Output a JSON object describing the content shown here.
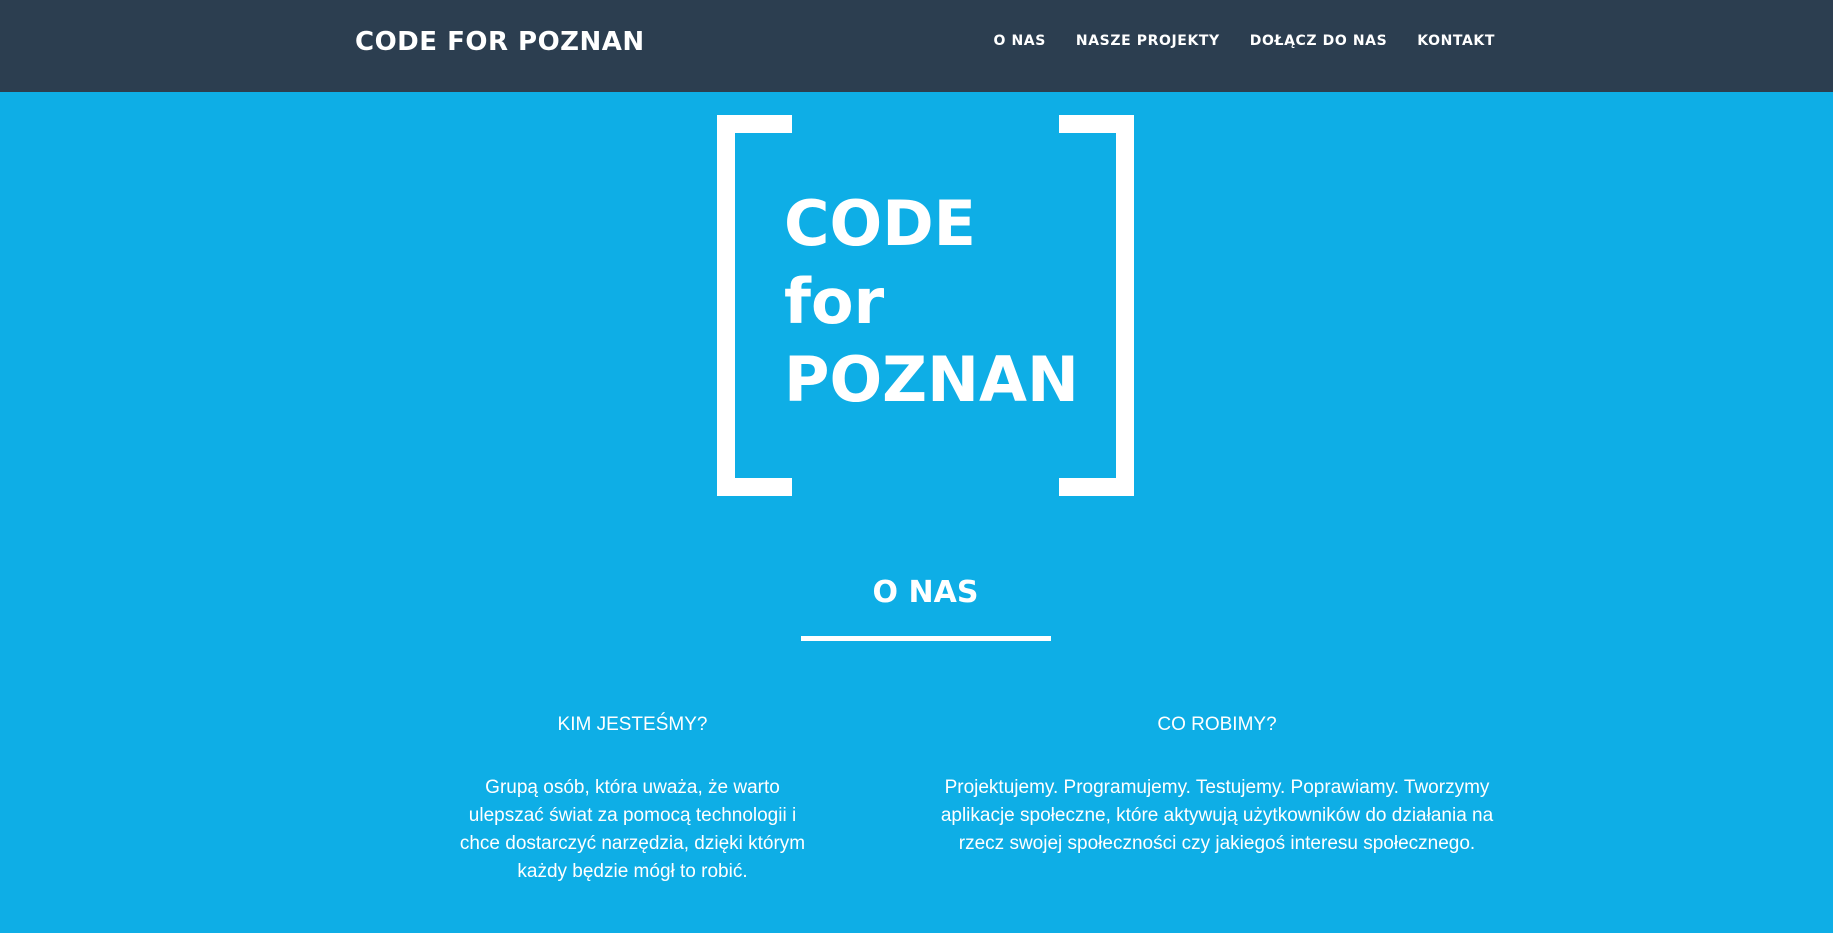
{
  "navbar": {
    "brand": "CODE FOR POZNAN",
    "links": [
      {
        "label": "O NAS"
      },
      {
        "label": "NASZE PROJEKTY"
      },
      {
        "label": "DOŁĄCZ DO NAS"
      },
      {
        "label": "KONTAKT"
      }
    ]
  },
  "logo": {
    "lines": [
      "CODE",
      "for",
      "POZNAN"
    ]
  },
  "about": {
    "title": "O NAS",
    "columns": [
      {
        "heading": "KIM JESTEŚMY?",
        "text": "Grupą osób, która uważa, że warto ulepszać świat za pomocą technologii i chce dostarczyć narzędzia, dzięki którym każdy będzie mógł to robić."
      },
      {
        "heading": "CO ROBIMY?",
        "text": "Projektujemy. Programujemy. Testujemy. Poprawiamy. Tworzymy aplikacje społeczne, które aktywują użytkowników do działania na rzecz swojej społeczności czy jakiegoś interesu społecznego."
      }
    ]
  },
  "colors": {
    "navbar_bg": "#2c3e50",
    "page_bg": "#0eaee6",
    "text": "#ffffff"
  }
}
